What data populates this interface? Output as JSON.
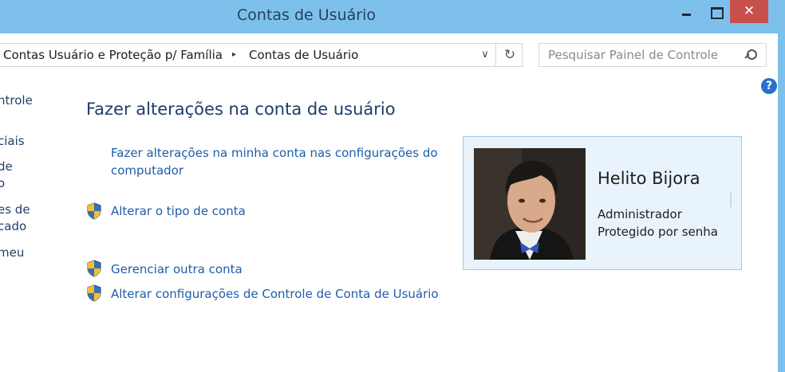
{
  "window": {
    "title": "Contas de Usuário",
    "close_label": "✕"
  },
  "address_bar": {
    "breadcrumbs": [
      "Contas Usuário e Proteção p/ Família",
      "Contas de Usuário"
    ],
    "separator": "▸",
    "dropdown": "∨",
    "refresh": "↻"
  },
  "search": {
    "placeholder": "Pesquisar Painel de Controle"
  },
  "help": {
    "label": "?"
  },
  "left_pane": {
    "items": [
      "ntrole",
      "ciais",
      "de",
      "o",
      "es de",
      "cado",
      "meu"
    ]
  },
  "main": {
    "heading": "Fazer alterações na conta de usuário",
    "links": [
      {
        "line1": "Fazer alterações na minha conta nas configurações do",
        "line2": "computador"
      },
      {
        "label": "Alterar o tipo de conta"
      },
      {
        "label": "Gerenciar outra conta"
      },
      {
        "label": "Alterar configurações de Controle de Conta de Usuário"
      }
    ]
  },
  "user": {
    "name": "Helito Bijora",
    "role": "Administrador",
    "protection": "Protegido por senha"
  },
  "colors": {
    "titlebar": "#7ec0ec",
    "close_button": "#c7504b",
    "link": "#1e5ea8",
    "heading": "#1e3d6b",
    "card_background": "#e9f3fb",
    "card_border": "#9ccbe8"
  }
}
